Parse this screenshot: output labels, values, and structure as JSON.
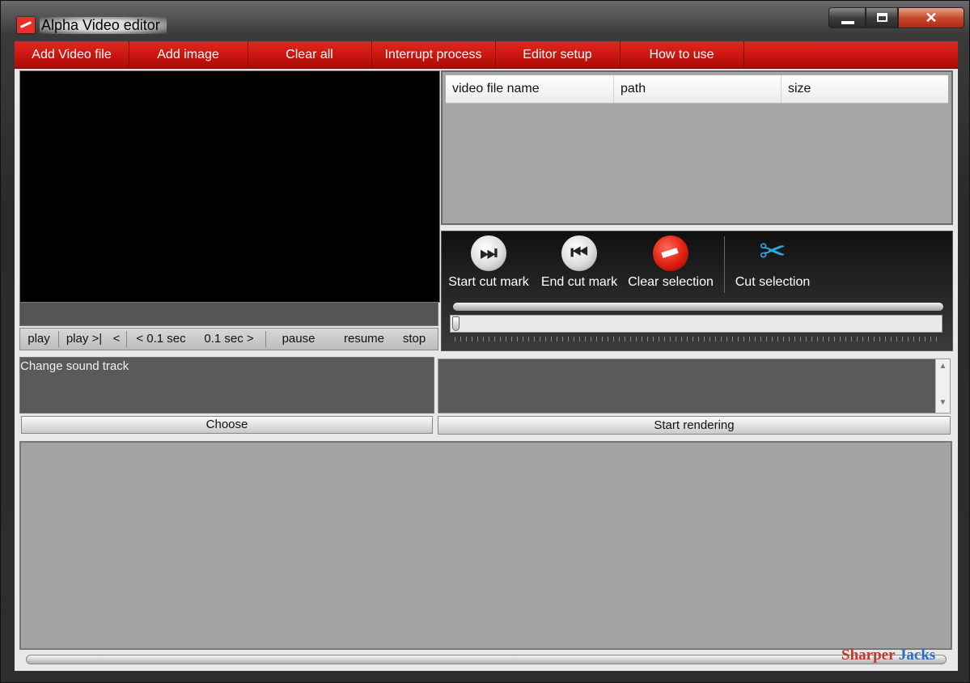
{
  "window": {
    "title": "Alpha Video editor"
  },
  "menu": [
    "Add Video file",
    "Add image",
    "Clear all",
    "Interrupt process",
    "Editor setup",
    "How to use"
  ],
  "playback": {
    "play": "play",
    "play_to_mark": "play >|",
    "back_one": "<",
    "back_step": "< 0.1 sec",
    "fwd_step": "0.1 sec >",
    "pause": "pause",
    "resume": "resume",
    "stop": "stop"
  },
  "file_table": {
    "columns": [
      "video file name",
      "path",
      "size"
    ],
    "rows": []
  },
  "cut_tools": {
    "start_cut": "Start cut mark",
    "end_cut": "End cut mark",
    "clear_selection": "Clear selection",
    "cut_selection": "Cut selection"
  },
  "sound": {
    "label": "Change sound track",
    "choose": "Choose"
  },
  "render": {
    "start": "Start rendering"
  },
  "watermark": {
    "part1": "Sharper",
    "part2": "Jacks"
  },
  "colors": {
    "menu_red": "#d11a12",
    "panel_gray": "#a4a4a4",
    "cut_icon_blue": "#2aa9e0"
  }
}
